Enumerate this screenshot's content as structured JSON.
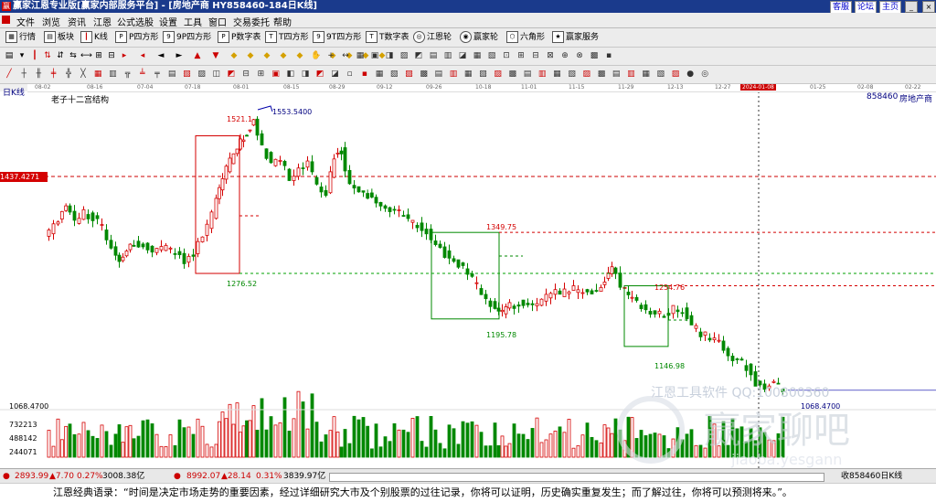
{
  "titlebar": {
    "title": "赢家江恩专业版[赢家内部服务平台] - [房地产商  HY858460-184日K线]",
    "buttons": [
      "客服",
      "论坛",
      "主页"
    ]
  },
  "menu": [
    "文件",
    "浏览",
    "资讯",
    "江恩",
    "公式选股",
    "设置",
    "工具",
    "窗口",
    "交易委托",
    "帮助"
  ],
  "toolbar1": [
    {
      "label": "行情",
      "icon": "grid-icon"
    },
    {
      "label": "板块",
      "icon": "blocks-icon"
    },
    {
      "label": "K线",
      "icon": "candle-icon"
    },
    {
      "label": "P四方形",
      "icon": "p-square-icon"
    },
    {
      "label": "9P四方形",
      "icon": "9p-square-icon"
    },
    {
      "label": "P数字表",
      "icon": "p-table-icon"
    },
    {
      "label": "T四方形",
      "icon": "t-square-icon"
    },
    {
      "label": "9T四方形",
      "icon": "9t-square-icon"
    },
    {
      "label": "T数字表",
      "icon": "t-table-icon"
    },
    {
      "label": "江恩轮",
      "icon": "wheel-icon"
    },
    {
      "label": "赢家轮",
      "icon": "winner-wheel-icon"
    },
    {
      "label": "六角形",
      "icon": "hexagon-icon"
    },
    {
      "label": "赢家服务",
      "icon": "service-icon"
    }
  ],
  "chart": {
    "period_label": "日K线",
    "study_label": "老子十二宫结构",
    "code_label": "858460",
    "name_label": "房地产商",
    "cursor_price": "1437.4271",
    "vol_axis": [
      "1068.4700",
      "732213",
      "488142",
      "244071"
    ],
    "annotations": {
      "high": "1553.5400",
      "box1_top": "1521.1",
      "box1_bottom": "1276.52",
      "box2_top": "1349.75",
      "box2_bottom": "1195.78",
      "box3_top": "1254.76",
      "box3_bottom": "1146.98",
      "last": "1068.4700"
    },
    "watermark1": "江恩工具软件 QQ:100800360",
    "watermark2": "赢家聊吧",
    "watermark3": "jiaoba.yesgann"
  },
  "date_axis": [
    "08-02",
    "08-16",
    "07-04",
    "07-18",
    "08-01",
    "08-15",
    "08-29",
    "09-12",
    "09-26",
    "10-18",
    "11-01",
    "11-15",
    "11-29",
    "12-13",
    "12-27",
    "2024-01-08",
    "01-25",
    "02-08",
    "02-22"
  ],
  "statusbar": {
    "idx1_price": "2893.99",
    "idx1_chg": "▲7.70",
    "idx1_pct": "0.27%",
    "idx1_amt": "3008.38亿",
    "idx2_price": "8992.07",
    "idx2_chg": "▲28.14",
    "idx2_pct": "0.31%",
    "idx2_amt": "3839.97亿",
    "right": "收858460日K线"
  },
  "footer": {
    "quote": "江恩经典语录：“时间是决定市场走势的重要因素，经过详细研究大市及个别股票的过往记录，你将可以证明，历史确实重复发生；而了解过往，你将可以预测将来。”。"
  },
  "colors": {
    "up": "#d40000",
    "down": "#008800",
    "box_red": "#d40000",
    "box_green": "#008800",
    "titlebar": "#1a3a8c"
  }
}
